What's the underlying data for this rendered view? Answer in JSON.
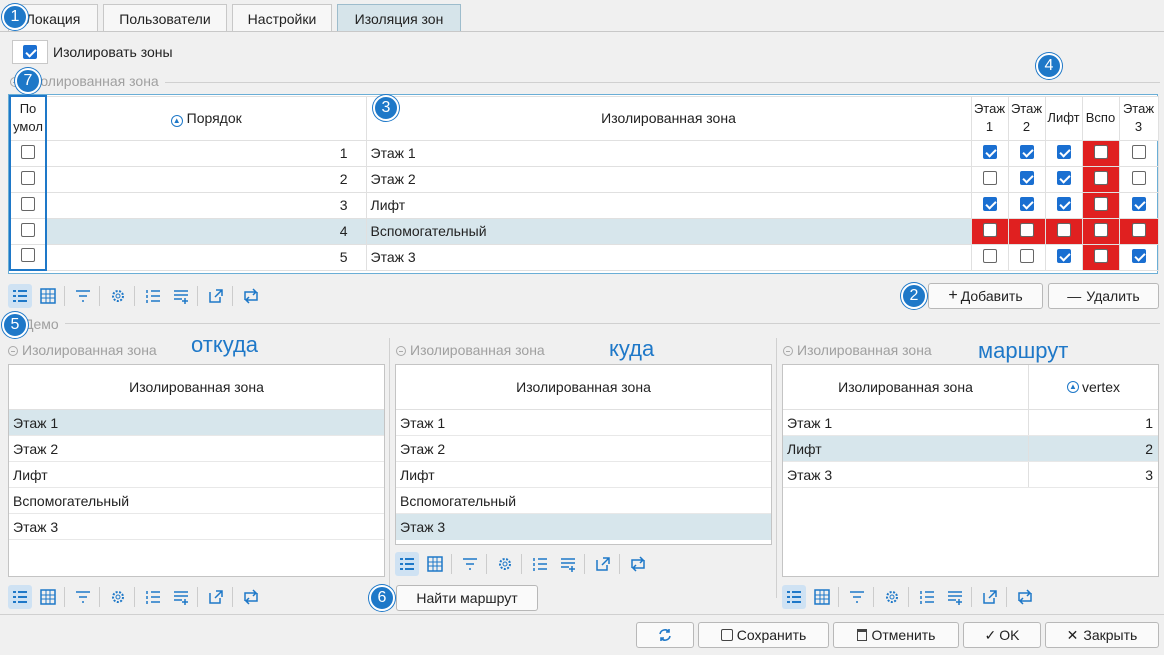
{
  "tabs": [
    "Локация",
    "Пользователи",
    "Настройки",
    "Изоляция зон"
  ],
  "isolate_label": "Изолировать зоны",
  "group_isolated": "Изолированная зона",
  "top_table": {
    "col_default": "По умол",
    "col_order": "Порядок",
    "col_zone": "Изолированная зона",
    "zone_cols": [
      "Этаж 1",
      "Этаж 2",
      "Лифт",
      "Вспо",
      "Этаж 3"
    ],
    "rows": [
      {
        "order": "1",
        "zone": "Этаж 1"
      },
      {
        "order": "2",
        "zone": "Этаж 2"
      },
      {
        "order": "3",
        "zone": "Лифт"
      },
      {
        "order": "4",
        "zone": "Вспомогательный"
      },
      {
        "order": "5",
        "zone": "Этаж 3"
      }
    ]
  },
  "add_label": "Добавить",
  "delete_label": "Удалить",
  "group_demo": "Демо",
  "demo": {
    "from_annot": "откуда",
    "to_annot": "куда",
    "route_annot": "маршрут",
    "col_zone": "Изолированная зона",
    "col_vertex": "vertex",
    "from_rows": [
      "Этаж 1",
      "Этаж 2",
      "Лифт",
      "Вспомогательный",
      "Этаж 3"
    ],
    "to_rows": [
      "Этаж 1",
      "Этаж 2",
      "Лифт",
      "Вспомогательный",
      "Этаж 3"
    ],
    "route_rows": [
      {
        "zone": "Этаж 1",
        "vertex": "1"
      },
      {
        "zone": "Лифт",
        "vertex": "2"
      },
      {
        "zone": "Этаж 3",
        "vertex": "3"
      }
    ],
    "find_label": "Найти маршрут"
  },
  "footer": {
    "save": "Сохранить",
    "cancel": "Отменить",
    "ok": "OK",
    "close": "Закрыть"
  },
  "badges": [
    "1",
    "2",
    "3",
    "4",
    "5",
    "6",
    "7"
  ],
  "colors": {
    "accent": "#1e78c8",
    "check": "#1a6fd1",
    "selected_row": "#d7e6ec",
    "highlight": "#e02020"
  }
}
